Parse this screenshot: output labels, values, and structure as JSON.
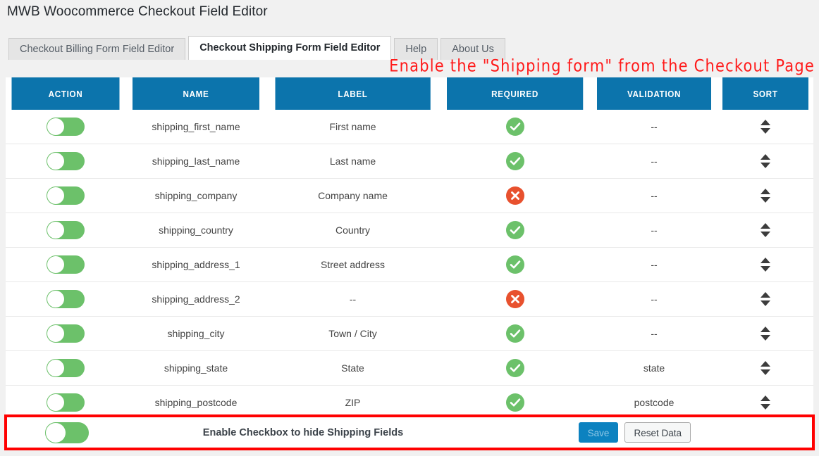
{
  "page": {
    "title": "MWB Woocommerce Checkout Field Editor",
    "background_color": "#f1f1f1"
  },
  "tabs": [
    {
      "label": "Checkout Billing Form Field Editor",
      "active": false
    },
    {
      "label": "Checkout Shipping Form Field Editor",
      "active": true
    },
    {
      "label": "Help",
      "active": false
    },
    {
      "label": "About Us",
      "active": false
    }
  ],
  "annotation": {
    "text": "Enable the \"Shipping form\" from the Checkout Page",
    "color": "#ff1a1a"
  },
  "table": {
    "header_color": "#0c74ac",
    "columns": [
      "ACTION",
      "NAME",
      "LABEL",
      "REQUIRED",
      "VALIDATION",
      "SORT"
    ],
    "rows": [
      {
        "action": "on",
        "name": "shipping_first_name",
        "label": "First name",
        "required": "yes",
        "validation": "--",
        "sort": "sort-handle"
      },
      {
        "action": "on",
        "name": "shipping_last_name",
        "label": "Last name",
        "required": "yes",
        "validation": "--",
        "sort": "sort-handle"
      },
      {
        "action": "on",
        "name": "shipping_company",
        "label": "Company name",
        "required": "no",
        "validation": "--",
        "sort": "sort-handle"
      },
      {
        "action": "on",
        "name": "shipping_country",
        "label": "Country",
        "required": "yes",
        "validation": "--",
        "sort": "sort-handle"
      },
      {
        "action": "on",
        "name": "shipping_address_1",
        "label": "Street address",
        "required": "yes",
        "validation": "--",
        "sort": "sort-handle"
      },
      {
        "action": "on",
        "name": "shipping_address_2",
        "label": "--",
        "required": "no",
        "validation": "--",
        "sort": "sort-handle"
      },
      {
        "action": "on",
        "name": "shipping_city",
        "label": "Town / City",
        "required": "yes",
        "validation": "--",
        "sort": "sort-handle"
      },
      {
        "action": "on",
        "name": "shipping_state",
        "label": "State",
        "required": "yes",
        "validation": "state",
        "sort": "sort-handle"
      },
      {
        "action": "on",
        "name": "shipping_postcode",
        "label": "ZIP",
        "required": "yes",
        "validation": "postcode",
        "sort": "sort-handle"
      }
    ]
  },
  "bottom_bar": {
    "toggle_state": "on",
    "label": "Enable Checkbox to hide Shipping Fields",
    "save_label": "Save",
    "reset_label": "Reset Data",
    "highlight_color": "#ff0000",
    "save_color": "#0c82c0"
  },
  "colors": {
    "toggle_on": "#6cc16a",
    "required_yes": "#6cc16a",
    "required_no": "#e8512e"
  }
}
